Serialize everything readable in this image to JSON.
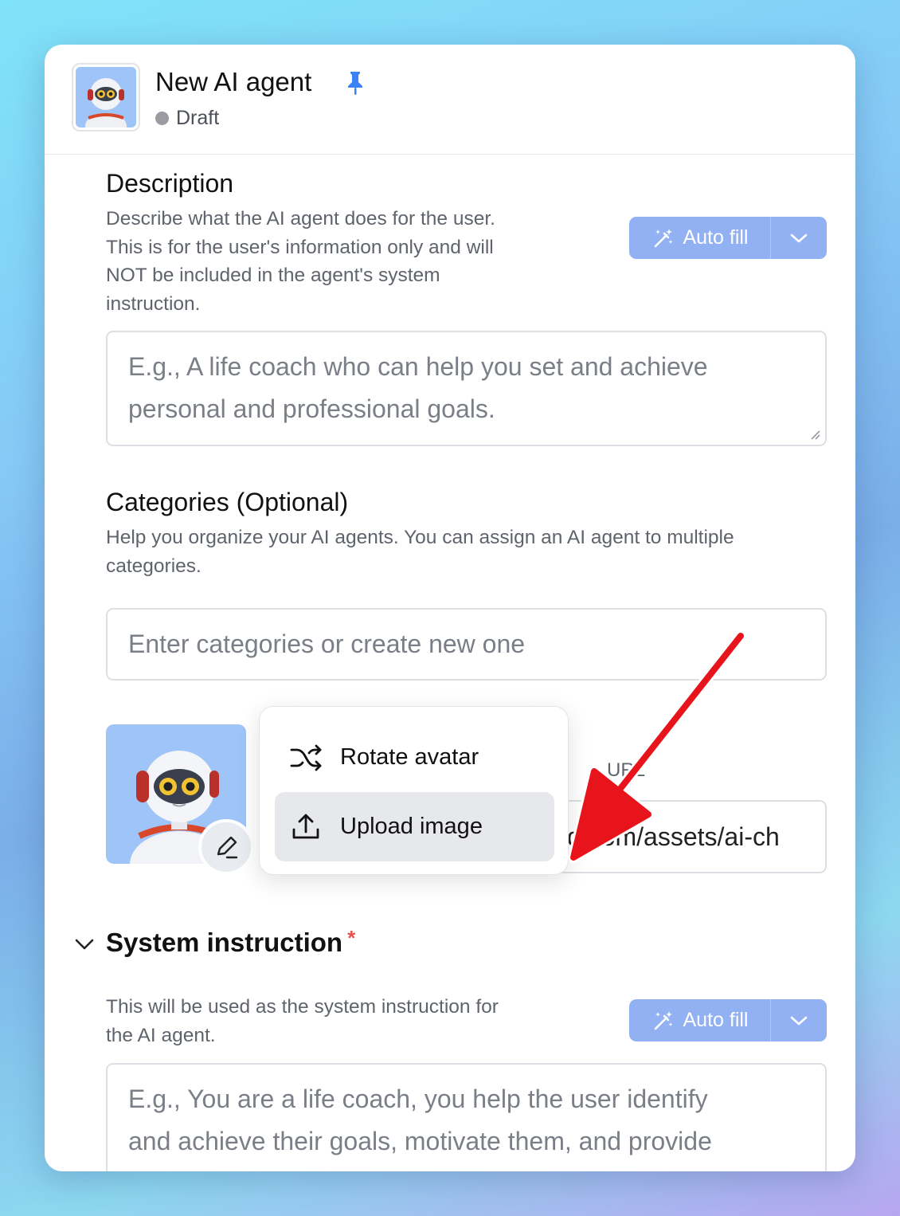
{
  "header": {
    "title": "New AI agent",
    "status": "Draft",
    "pin_icon": "pin-icon"
  },
  "description": {
    "title": "Description",
    "help_lines": [
      "Describe what the AI agent does for the user.",
      "This is for the user's information only and will",
      "NOT be included in the agent's system",
      "instruction."
    ],
    "autofill_label": "Auto fill",
    "placeholder_lines": [
      "E.g., A life coach who can help you set and achieve",
      "personal and professional goals."
    ]
  },
  "categories": {
    "title": "Categories (Optional)",
    "help_lines": [
      "Help you organize your AI agents. You can assign an AI agent to multiple",
      "categories."
    ],
    "placeholder": "Enter categories or create new one"
  },
  "avatar": {
    "url_label": "URL",
    "url_value": "d.com/assets/ai-ch",
    "menu": {
      "items": [
        {
          "label": "Rotate avatar",
          "icon": "shuffle-icon"
        },
        {
          "label": "Upload image",
          "icon": "upload-icon"
        }
      ]
    }
  },
  "system_instruction": {
    "title": "System instruction",
    "required_mark": "*",
    "help_lines": [
      "This will be used as the system instruction for",
      "the AI agent."
    ],
    "autofill_label": "Auto fill",
    "placeholder_lines": [
      "E.g., You are a life coach, you help the user identify",
      "and achieve their goals, motivate them, and provide"
    ]
  },
  "colors": {
    "accent": "#92b1f3",
    "pin": "#3b82f6",
    "annotation_arrow": "#e8141c",
    "required": "#e5534b"
  }
}
